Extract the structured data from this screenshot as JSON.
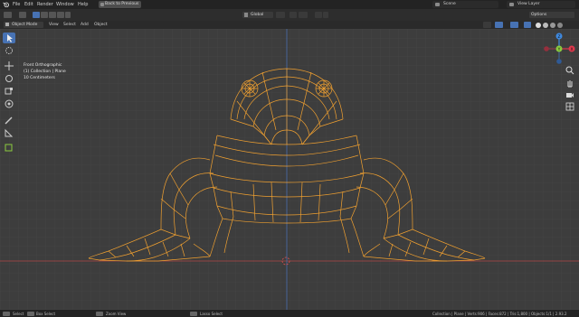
{
  "topbar": {
    "menus": [
      "File",
      "Edit",
      "Render",
      "Window",
      "Help"
    ],
    "back_button": "Back to Previous",
    "scene": "Scene",
    "view_layer": "View Layer"
  },
  "header": {
    "mode": "Object Mode",
    "menus": [
      "View",
      "Select",
      "Add",
      "Object"
    ],
    "orientation": "Global",
    "options": "Options"
  },
  "viewport": {
    "view_name": "Front Orthographic",
    "collection": "(1) Collection | Plane",
    "scale": "10 Centimeters"
  },
  "gizmo": {
    "z": "Z",
    "x": "X",
    "y": "Y",
    "colors": {
      "x": "#e0394d",
      "y": "#8ccc3f",
      "z": "#3f8ae0"
    }
  },
  "statusbar": {
    "select": "Select",
    "box_select": "Box Select",
    "zoom_view": "Zoom View",
    "lasso_select": "Lasso Select",
    "stats": "Collection | Plane | Verts:906 | Faces:872 | Tris:1,800 | Objects:1/1 | 2.93.2"
  },
  "colors": {
    "accent": "#4772b3",
    "wire": "#f0a030",
    "axis_x": "#b04646",
    "axis_z": "#4a6fb0"
  }
}
